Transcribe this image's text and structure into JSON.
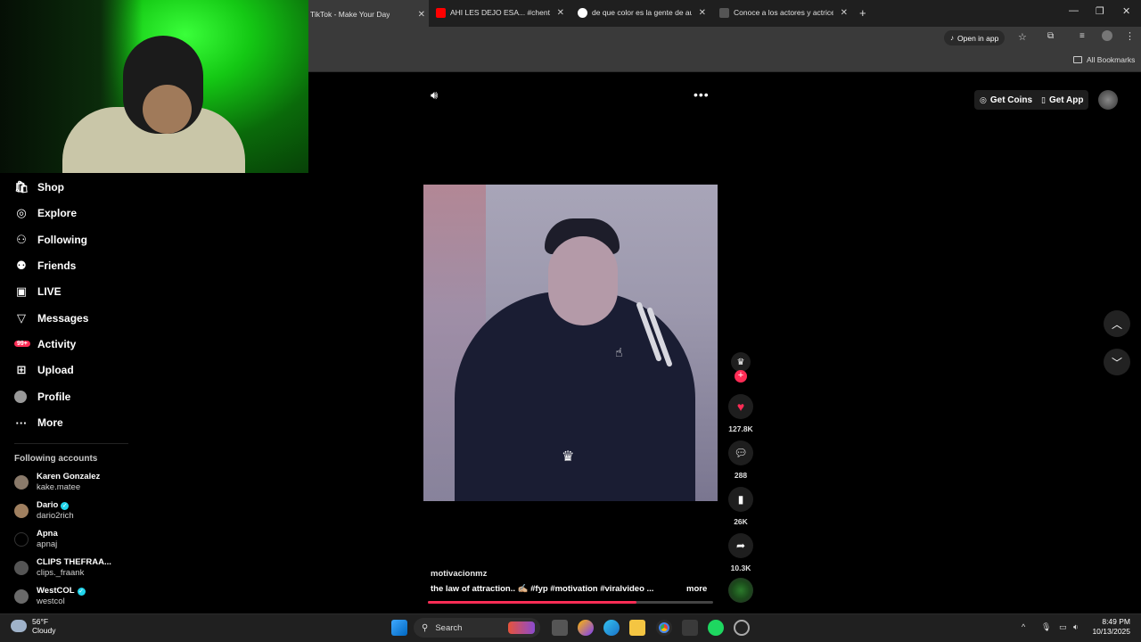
{
  "browser": {
    "tabs": [
      {
        "title": "TikTok - Make Your Day",
        "active": true,
        "favicon": "tiktok-icon"
      },
      {
        "title": "AHI LES DEJO ESA... #chenteyd",
        "active": false,
        "favicon": "youtube-icon"
      },
      {
        "title": "de que color es la gente de au",
        "active": false,
        "favicon": "google-icon"
      },
      {
        "title": "Conoce a los actores y actrices",
        "active": false,
        "favicon": "page-icon"
      }
    ],
    "new_tab": "+",
    "open_in_app": "Open in app",
    "all_bookmarks": "All Bookmarks"
  },
  "sidebar": {
    "items": [
      {
        "label": "Shop",
        "icon": "shop-icon"
      },
      {
        "label": "Explore",
        "icon": "compass-icon"
      },
      {
        "label": "Following",
        "icon": "user-icon"
      },
      {
        "label": "Friends",
        "icon": "friends-icon"
      },
      {
        "label": "LIVE",
        "icon": "live-icon"
      },
      {
        "label": "Messages",
        "icon": "send-icon"
      },
      {
        "label": "Activity",
        "icon": "bell-icon",
        "badge": "99+"
      },
      {
        "label": "Upload",
        "icon": "plus-square-icon"
      },
      {
        "label": "Profile",
        "icon": "avatar-icon"
      },
      {
        "label": "More",
        "icon": "ellipsis-icon"
      }
    ],
    "following_title": "Following accounts",
    "accounts": [
      {
        "name": "Karen Gonzalez",
        "handle": "kake.matee",
        "verified": false
      },
      {
        "name": "Dario",
        "handle": "dario2rich",
        "verified": true
      },
      {
        "name": "Apna",
        "handle": "apnaj",
        "verified": false
      },
      {
        "name": "CLIPS THEFRAA...",
        "handle": "clips._fraank",
        "verified": false
      },
      {
        "name": "WestCOL",
        "handle": "westcol",
        "verified": true
      }
    ]
  },
  "header": {
    "get_coins": "Get Coins",
    "get_app": "Get App"
  },
  "video": {
    "author": "motivacionmz",
    "caption": "the law of attraction.. ✍🏼 #fyp #motivation #viralvideo ...",
    "more": "more",
    "progress": 0.73,
    "stats": {
      "likes": "127.8K",
      "comments": "288",
      "saves": "26K",
      "shares": "10.3K"
    }
  },
  "taskbar": {
    "weather_temp": "56°F",
    "weather_desc": "Cloudy",
    "search": "Search",
    "time": "8:49 PM",
    "date": "10/13/2025"
  },
  "colors": {
    "accent": "#fe2c55",
    "verified": "#20d5ec"
  }
}
